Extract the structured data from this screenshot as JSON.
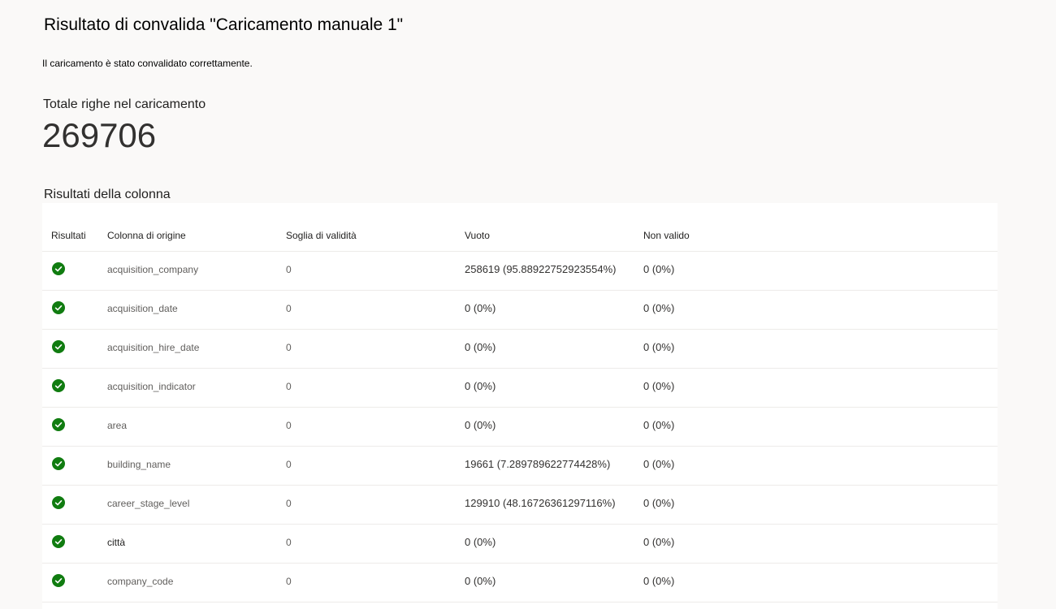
{
  "page": {
    "title": "Risultato di convalida \"Caricamento manuale 1\"",
    "message": "Il caricamento è stato convalidato correttamente."
  },
  "total": {
    "label": "Totale righe nel caricamento",
    "value": "269706"
  },
  "column_results": {
    "title": "Risultati della colonna",
    "headers": {
      "results": "Risultati",
      "source_column": "Colonna di origine",
      "threshold": "Soglia di validità",
      "empty": "Vuoto",
      "invalid": "Non valido"
    },
    "status_color": "#107c10",
    "status_icon": "check-circle-icon",
    "rows": [
      {
        "source_column": "acquisition_company",
        "threshold": "0",
        "empty": "258619 (95.88922752923554%)",
        "invalid": "0 (0%)"
      },
      {
        "source_column": "acquisition_date",
        "threshold": "0",
        "empty": "0 (0%)",
        "invalid": "0 (0%)"
      },
      {
        "source_column": "acquisition_hire_date",
        "threshold": "0",
        "empty": "0 (0%)",
        "invalid": "0 (0%)"
      },
      {
        "source_column": "acquisition_indicator",
        "threshold": "0",
        "empty": "0 (0%)",
        "invalid": "0 (0%)"
      },
      {
        "source_column": "area",
        "threshold": "0",
        "empty": "0 (0%)",
        "invalid": "0 (0%)"
      },
      {
        "source_column": "building_name",
        "threshold": "0",
        "empty": "19661 (7.289789622774428%)",
        "invalid": "0 (0%)"
      },
      {
        "source_column": "career_stage_level",
        "threshold": "0",
        "empty": "129910 (48.16726361297116%)",
        "invalid": "0 (0%)"
      },
      {
        "source_column": "città",
        "threshold": "0",
        "empty": "0 (0%)",
        "invalid": "0 (0%)"
      },
      {
        "source_column": "company_code",
        "threshold": "0",
        "empty": "0 (0%)",
        "invalid": "0 (0%)"
      }
    ]
  }
}
